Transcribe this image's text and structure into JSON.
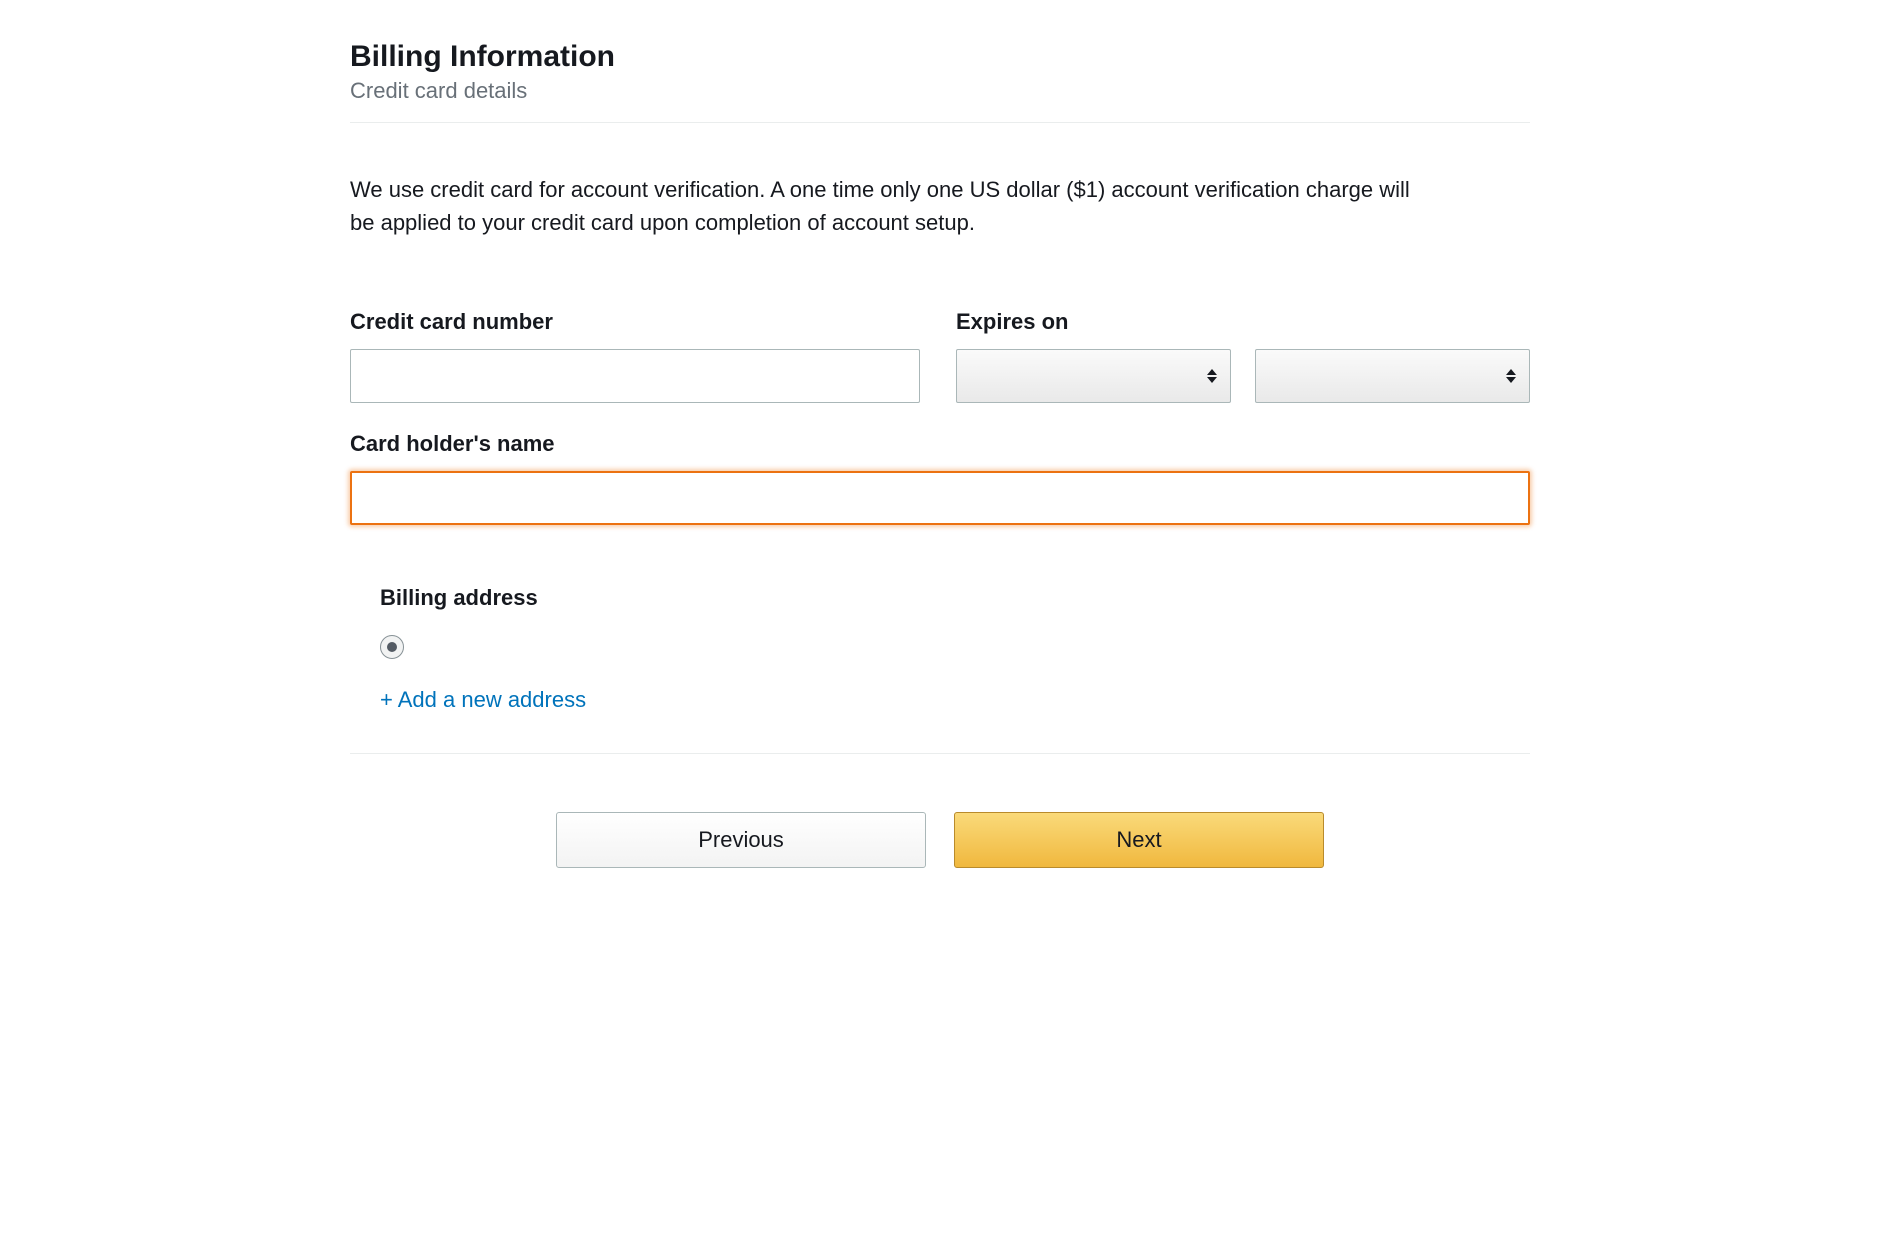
{
  "header": {
    "title": "Billing Information",
    "subtitle": "Credit card details"
  },
  "description": "We use credit card for account verification. A one time only one US dollar ($1) account verification charge will be applied to your credit card upon completion of account setup.",
  "fields": {
    "cc_number_label": "Credit card number",
    "cc_number_value": "",
    "expires_label": "Expires on",
    "expires_month_value": "",
    "expires_year_value": "",
    "cardholder_label": "Card holder's name",
    "cardholder_value": ""
  },
  "billing": {
    "label": "Billing address",
    "add_new_link": "+ Add a new address"
  },
  "buttons": {
    "previous": "Previous",
    "next": "Next"
  },
  "colors": {
    "focus_orange": "#ec7211",
    "link_blue": "#0073bb",
    "primary_button_top": "#fada7a",
    "primary_button_bottom": "#f0b83e"
  }
}
